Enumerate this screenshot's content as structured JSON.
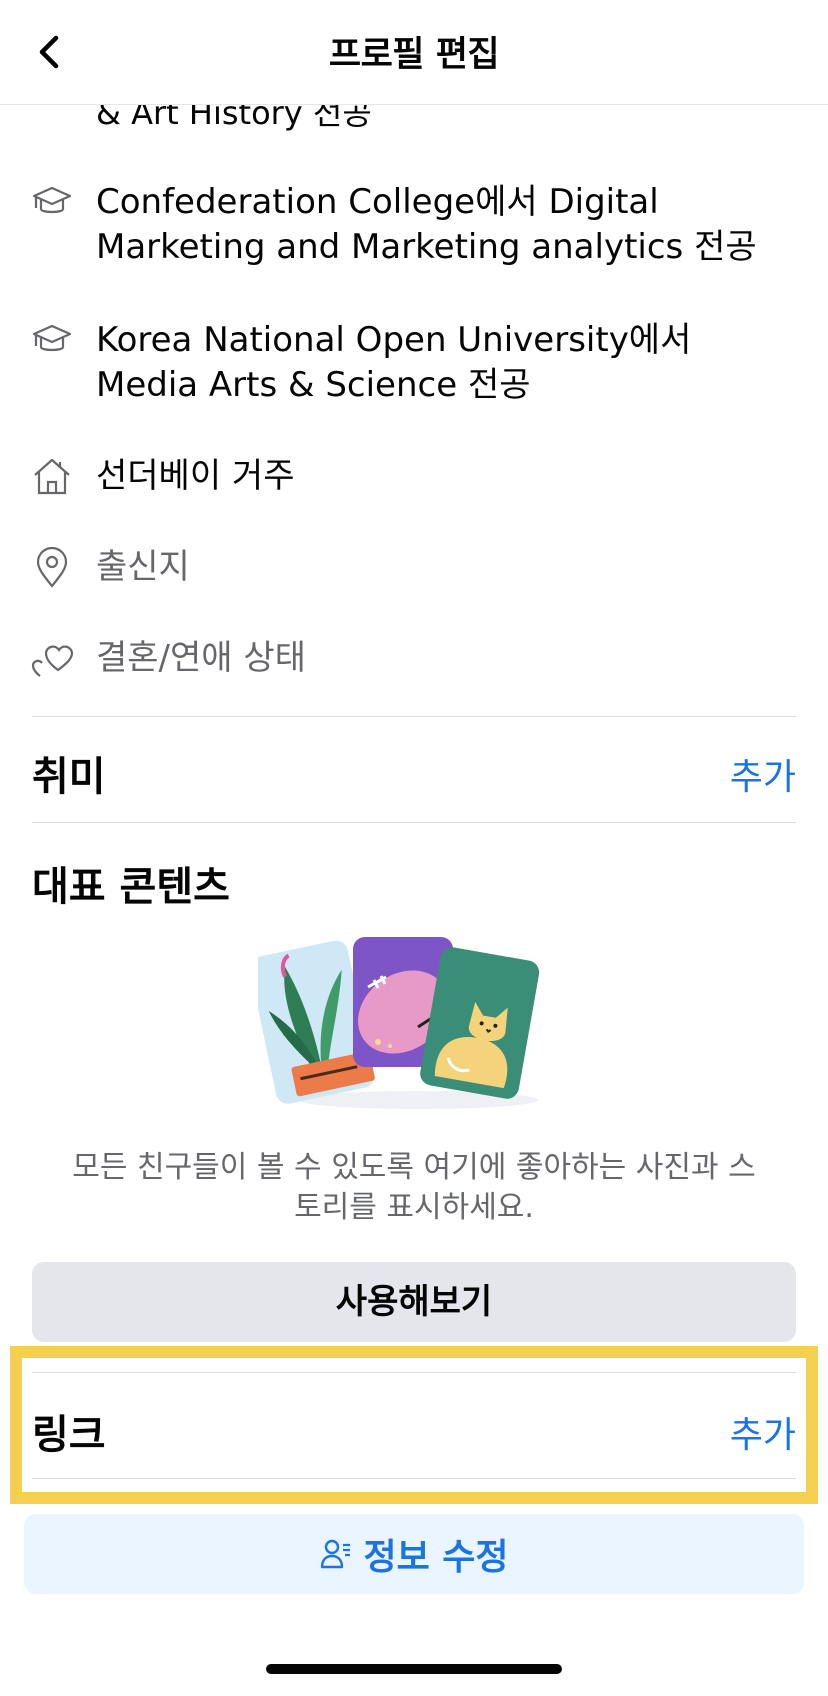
{
  "header": {
    "title": "프로필 편집"
  },
  "intro": {
    "cut_text": "& Art History 전공",
    "items": [
      {
        "icon": "graduation-cap-icon",
        "line1": "Confederation College에서 Digital",
        "line2": "Marketing and Marketing analytics 전공"
      },
      {
        "icon": "graduation-cap-icon",
        "line1": "Korea National Open University에서",
        "line2": "Media Arts & Science 전공"
      },
      {
        "icon": "house-icon",
        "text": "선더베이 거주"
      },
      {
        "icon": "location-pin-icon",
        "text": "출신지"
      },
      {
        "icon": "heart-icon",
        "text": "결혼/연애 상태"
      }
    ]
  },
  "hobbies": {
    "title": "취미",
    "add_label": "추가"
  },
  "featured": {
    "title": "대표 콘텐츠",
    "description_line1": "모든 친구들이 볼 수 있도록 여기에 좋아하는 사진과 스",
    "description_line2": "토리를 표시하세요.",
    "button_label": "사용해보기"
  },
  "links": {
    "title": "링크",
    "add_label": "추가"
  },
  "edit_info": {
    "label": "정보 수정",
    "icon": "person-edit-icon"
  },
  "colors": {
    "accent": "#1b74e4",
    "highlight": "#f5cf4f"
  }
}
